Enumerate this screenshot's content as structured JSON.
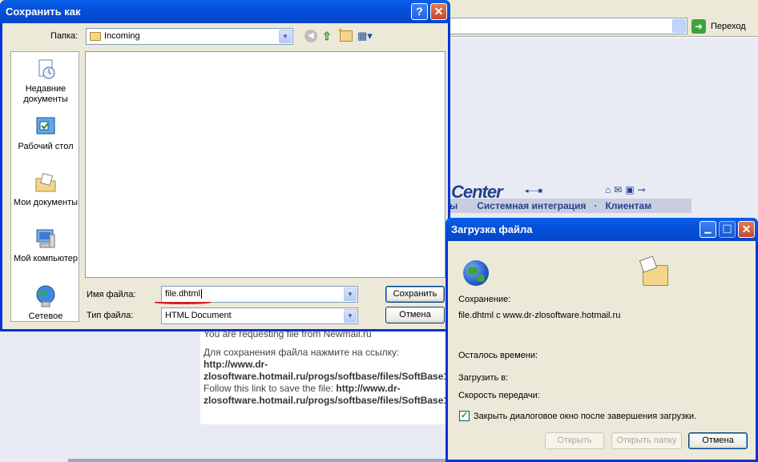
{
  "browser": {
    "go_label": "Переход",
    "banner_logo": "Center",
    "banner_menu": [
      "ы",
      "Системная интеграция",
      "·",
      "Клиентам"
    ],
    "page_text": {
      "partial_line": "You are requesting file from Newmail.ru",
      "ru_line1": "Для сохранения файла нажмите на ссылку: ",
      "ru_link": "http://www.dr-zlosoftware.hotmail.ru/progs/softbase/files/SoftBase1",
      "en_line1": "Follow this link to save the file: ",
      "en_link": "http://www.dr-zlosoftware.hotmail.ru/progs/softbase/files/SoftBase1"
    }
  },
  "save_dialog": {
    "title": "Сохранить как",
    "help_btn": "?",
    "close_btn": "✕",
    "lookin_label": "Папка:",
    "lookin_value": "Incoming",
    "places": [
      {
        "label": "Недавние документы",
        "icon": "recent-documents-icon"
      },
      {
        "label": "Рабочий стол",
        "icon": "desktop-icon"
      },
      {
        "label": "Мои документы",
        "icon": "my-documents-icon"
      },
      {
        "label": "Мой компьютер",
        "icon": "my-computer-icon"
      },
      {
        "label": "Сетевое",
        "icon": "network-icon"
      }
    ],
    "filename_label": "Имя файла:",
    "filename_value": "file.dhtml",
    "filetype_label": "Тип файла:",
    "filetype_value": "HTML Document",
    "save_label": "Сохранить",
    "cancel_label": "Отмена"
  },
  "download_dialog": {
    "title": "Загрузка файла",
    "saving_label": "Сохранение:",
    "saving_value": "file.dhtml с www.dr-zlosoftware.hotmail.ru",
    "time_left_label": "Осталось времени:",
    "download_to_label": "Загрузить в:",
    "rate_label": "Скорость передачи:",
    "close_on_complete_label": "Закрыть диалоговое окно после завершения загрузки.",
    "close_on_complete_checked": true,
    "open_label": "Открыть",
    "open_folder_label": "Открыть папку",
    "cancel_label": "Отмена"
  },
  "colors": {
    "xp_title_blue": "#0551DB",
    "dialog_face": "#ECE9D8",
    "banner_navy": "#263F8E",
    "annotation_red": "#D82020"
  }
}
